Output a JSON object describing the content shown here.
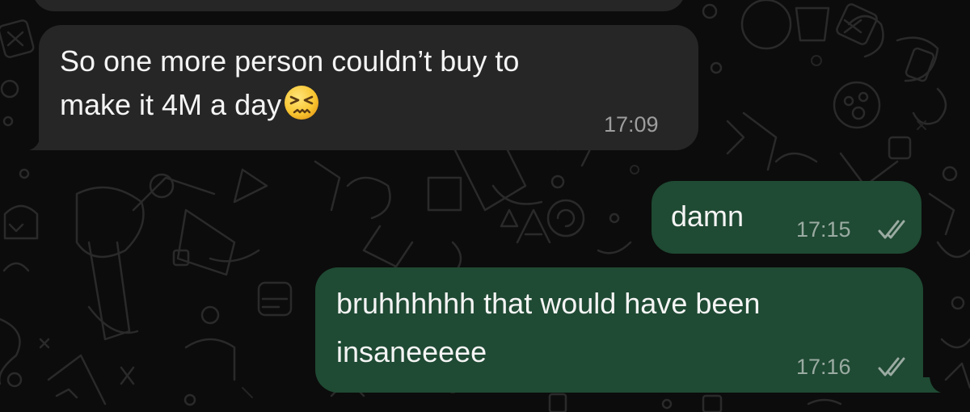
{
  "messages": [
    {
      "direction": "incoming",
      "lines": [
        "So one more person couldn’t buy to",
        "make it 4M a day"
      ],
      "emoji": "persevering-face",
      "time": "17:09"
    },
    {
      "direction": "outgoing",
      "lines": [
        "damn"
      ],
      "time": "17:15",
      "status": "read"
    },
    {
      "direction": "outgoing",
      "lines": [
        "bruhhhhhh that would have been",
        "insaneeeee"
      ],
      "time": "17:16",
      "status": "read"
    }
  ],
  "colors": {
    "background": "#0c0c0c",
    "incoming_bubble": "#262626",
    "outgoing_bubble": "#1f4a33",
    "text": "#f4f4f4",
    "timestamp": "#9c9c9c"
  }
}
